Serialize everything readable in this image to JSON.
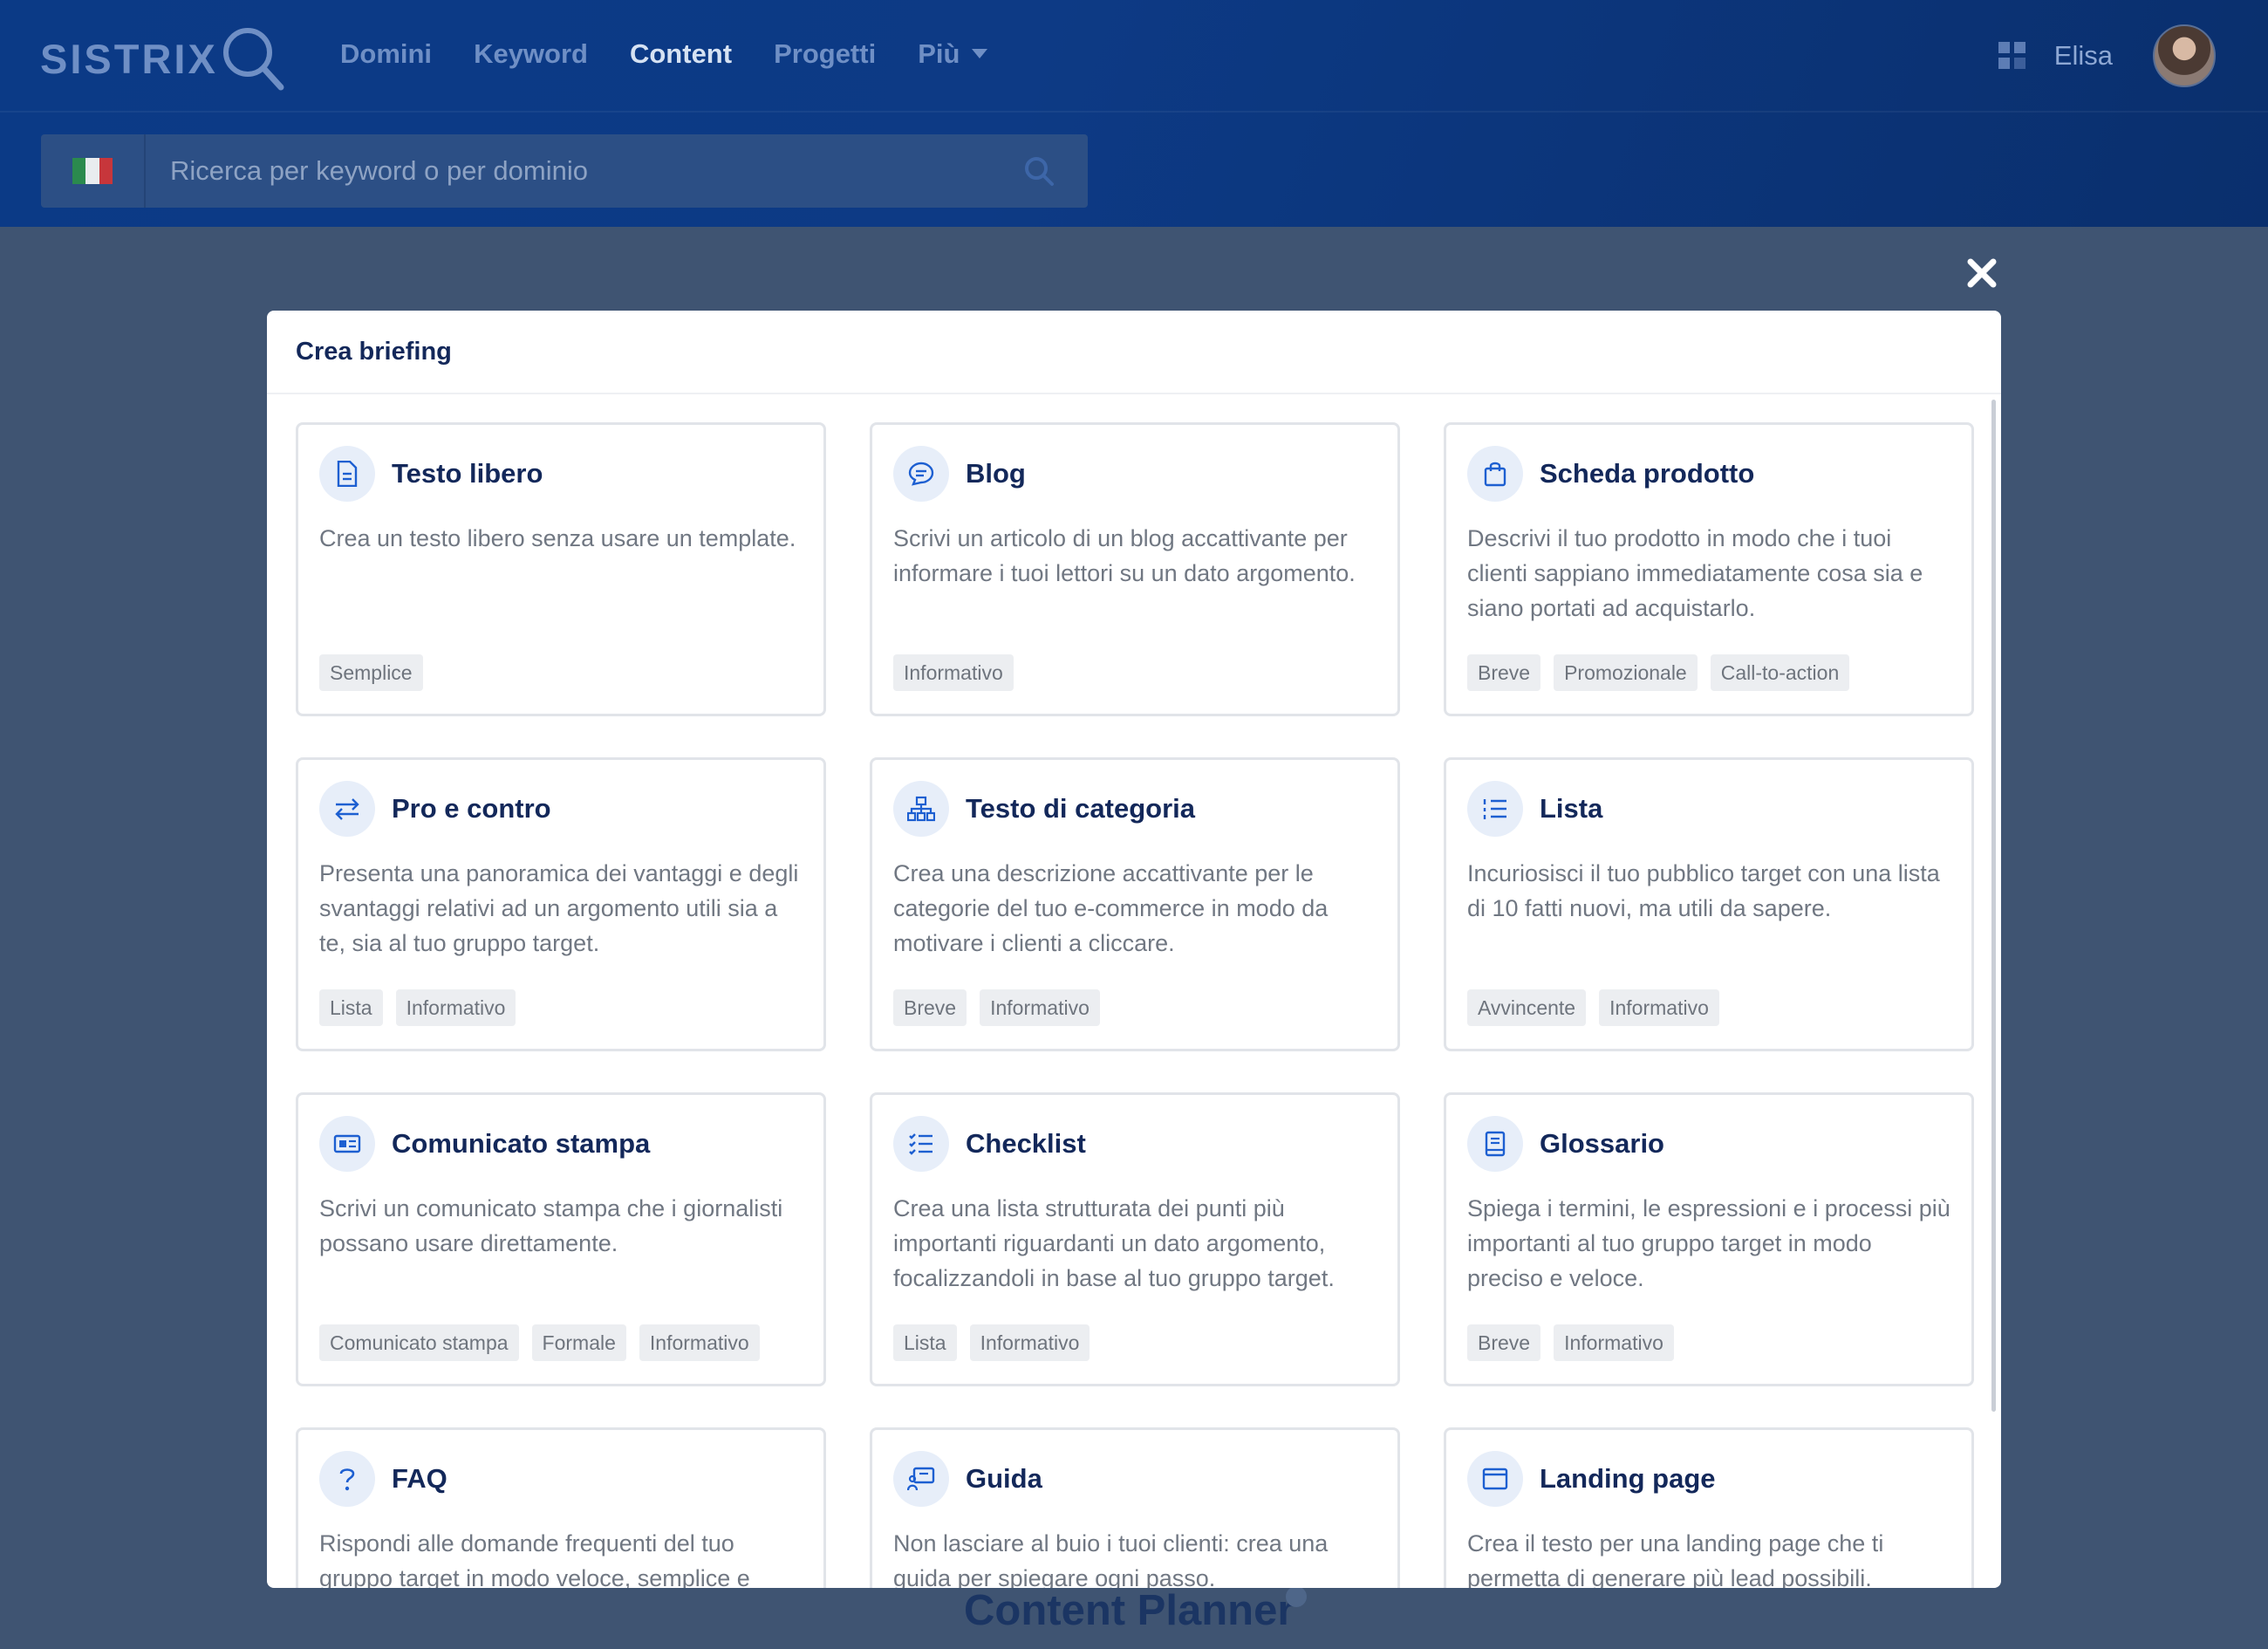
{
  "header": {
    "logo_text": "SISTRIX",
    "nav": [
      "Domini",
      "Keyword",
      "Content",
      "Progetti"
    ],
    "nav_more": "Più",
    "user_name": "Elisa",
    "search_placeholder": "Ricerca per keyword o per dominio"
  },
  "modal": {
    "title": "Crea briefing",
    "cards": [
      {
        "title": "Testo libero",
        "icon": "document-icon",
        "desc": "Crea un testo libero senza usare un template.",
        "tags": [
          "Semplice"
        ]
      },
      {
        "title": "Blog",
        "icon": "chat-icon",
        "desc": "Scrivi un articolo di un blog accattivante per informare i tuoi lettori su un dato argomento.",
        "tags": [
          "Informativo"
        ]
      },
      {
        "title": "Scheda prodotto",
        "icon": "shopping-bag-icon",
        "desc": "Descrivi il tuo prodotto in modo che i tuoi clienti sappiano immediatamente cosa sia e siano portati ad acquistarlo.",
        "tags": [
          "Breve",
          "Promozionale",
          "Call-to-action"
        ]
      },
      {
        "title": "Pro e contro",
        "icon": "arrows-swap-icon",
        "desc": "Presenta una panoramica dei vantaggi e degli svantaggi relativi ad un argomento utili sia a te, sia al tuo gruppo target.",
        "tags": [
          "Lista",
          "Informativo"
        ]
      },
      {
        "title": "Testo di categoria",
        "icon": "sitemap-icon",
        "desc": "Crea una descrizione accattivante per le categorie del tuo e-commerce in modo da motivare i clienti a cliccare.",
        "tags": [
          "Breve",
          "Informativo"
        ]
      },
      {
        "title": "Lista",
        "icon": "numbered-list-icon",
        "desc": "Incuriosisci il tuo pubblico target con una lista di 10 fatti nuovi, ma utili da sapere.",
        "tags": [
          "Avvincente",
          "Informativo"
        ]
      },
      {
        "title": "Comunicato stampa",
        "icon": "newspaper-icon",
        "desc": "Scrivi un comunicato stampa che i giornalisti possano usare direttamente.",
        "tags": [
          "Comunicato stampa",
          "Formale",
          "Informativo"
        ]
      },
      {
        "title": "Checklist",
        "icon": "checklist-icon",
        "desc": "Crea una lista strutturata dei punti più importanti riguardanti un dato argomento, focalizzandoli in base al tuo gruppo target.",
        "tags": [
          "Lista",
          "Informativo"
        ]
      },
      {
        "title": "Glossario",
        "icon": "book-icon",
        "desc": "Spiega i termini, le espressioni e i processi più importanti al tuo gruppo target in modo preciso e veloce.",
        "tags": [
          "Breve",
          "Informativo"
        ]
      },
      {
        "title": "FAQ",
        "icon": "question-icon",
        "desc": "Rispondi alle domande frequenti del tuo gruppo target in modo veloce, semplice e",
        "tags": []
      },
      {
        "title": "Guida",
        "icon": "presentation-icon",
        "desc": "Non lasciare al buio i tuoi clienti: crea una guida per spiegare ogni passo.",
        "tags": []
      },
      {
        "title": "Landing page",
        "icon": "browser-window-icon",
        "desc": "Crea il testo per una landing page che ti permetta di generare più lead possibili.",
        "tags": []
      }
    ]
  },
  "background": {
    "page_title": "Content Planner"
  },
  "colors": {
    "header": "#0b3a86",
    "overlay": "#3f5472",
    "accent": "#1d5fd1",
    "title": "#13285a"
  }
}
